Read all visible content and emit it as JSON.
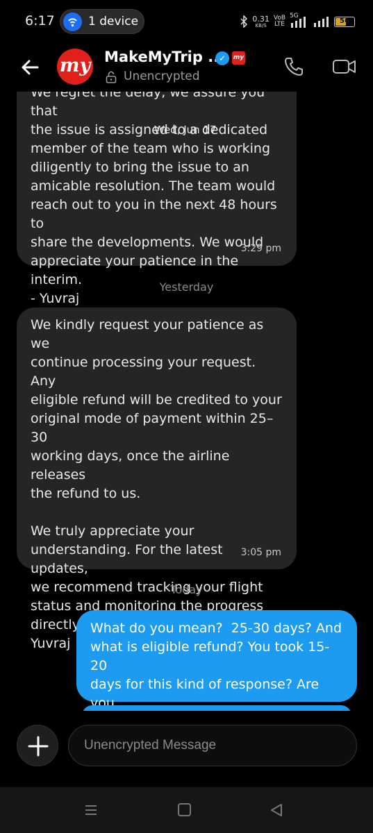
{
  "status_bar": {
    "time": "6:17",
    "device_pill": "1 device",
    "net_speed_top": "0.31",
    "net_speed_bottom": "KB/S",
    "volte_top": "VoB",
    "volte_bottom": "LTE",
    "network": "5G",
    "battery": "56"
  },
  "header": {
    "avatar_text": "my",
    "brand_badge_text": "my",
    "contact_name": "MakeMyTrip ...",
    "encryption_status": "Unencrypted"
  },
  "chat": {
    "messages": [
      {
        "direction": "incoming",
        "text": "We regret the delay, we assure you that\nthe issue is assigned to a dedicated\nmember of the team who is working\ndiligently to bring the issue to an\namicable resolution. The team would\nreach out to you in the next 48 hours to\nshare the developments. We would\nappreciate your patience in the interim.\n- Yuvraj",
        "time": "3:29 pm"
      },
      {
        "direction": "incoming",
        "text": "We kindly request your patience as we\ncontinue processing your request. Any\neligible refund will be credited to your\noriginal mode of payment within 25–30\nworking days, once the airline releases\nthe refund to us.\n\nWe truly appreciate your\nunderstanding. For the latest updates,\nwe recommend tracking your flight\nstatus and monitoring the progress\ndirectly through the MyTrips section. -\nYuvraj",
        "time": "3:05 pm"
      },
      {
        "direction": "outgoing",
        "text": "What do you mean?  25-30 days? And\nwhat is eligible refund? You took 15-20\ndays for this kind of response? Are you\nfr?"
      }
    ],
    "floating_date": "Wed, Jun 17",
    "separators": [
      "Yesterday",
      "Today"
    ]
  },
  "composer": {
    "placeholder": "Unencrypted Message"
  },
  "colors": {
    "accent": "#1d9bf0",
    "incoming_bubble": "#242526",
    "brand": "#e2211c"
  },
  "icons": [
    "back-arrow-icon",
    "verified-icon",
    "lock-icon",
    "phone-icon",
    "video-icon",
    "plus-icon",
    "arrow-down-icon",
    "menu-icon",
    "home-icon",
    "nav-back-icon"
  ]
}
